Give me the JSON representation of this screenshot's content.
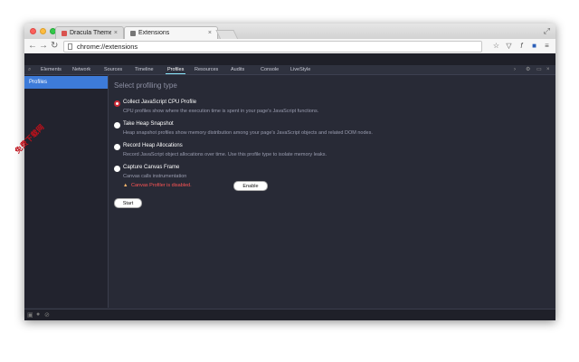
{
  "browser": {
    "tabs": [
      {
        "title": "Dracula Theme for DevTo",
        "favicon_color": "#d9534f"
      },
      {
        "title": "Extensions",
        "favicon_color": "#777777"
      }
    ],
    "url": "chrome://extensions"
  },
  "devtools": {
    "tabs": [
      "Elements",
      "Network",
      "Sources",
      "Timeline",
      "Profiles",
      "Resources",
      "Audits",
      "Console",
      "LiveStyle"
    ],
    "active_tab": "Profiles",
    "sidebar": {
      "items": [
        {
          "label": "Profiles",
          "selected": true
        }
      ]
    },
    "profiles": {
      "heading": "Select profiling type",
      "options": [
        {
          "title": "Collect JavaScript CPU Profile",
          "desc": "CPU profiles show where the execution time is spent in your page's JavaScript functions.",
          "checked": true
        },
        {
          "title": "Take Heap Snapshot",
          "desc": "Heap snapshot profiles show memory distribution among your page's JavaScript objects and related DOM nodes.",
          "checked": false
        },
        {
          "title": "Record Heap Allocations",
          "desc": "Record JavaScript object allocations over time. Use this profile type to isolate memory leaks.",
          "checked": false
        },
        {
          "title": "Capture Canvas Frame",
          "desc": "Canvas calls instrumentation",
          "checked": false
        }
      ],
      "warning": "Canvas Profiler is disabled.",
      "enable_label": "Enable",
      "start_label": "Start"
    }
  },
  "watermark": "免费下载网"
}
